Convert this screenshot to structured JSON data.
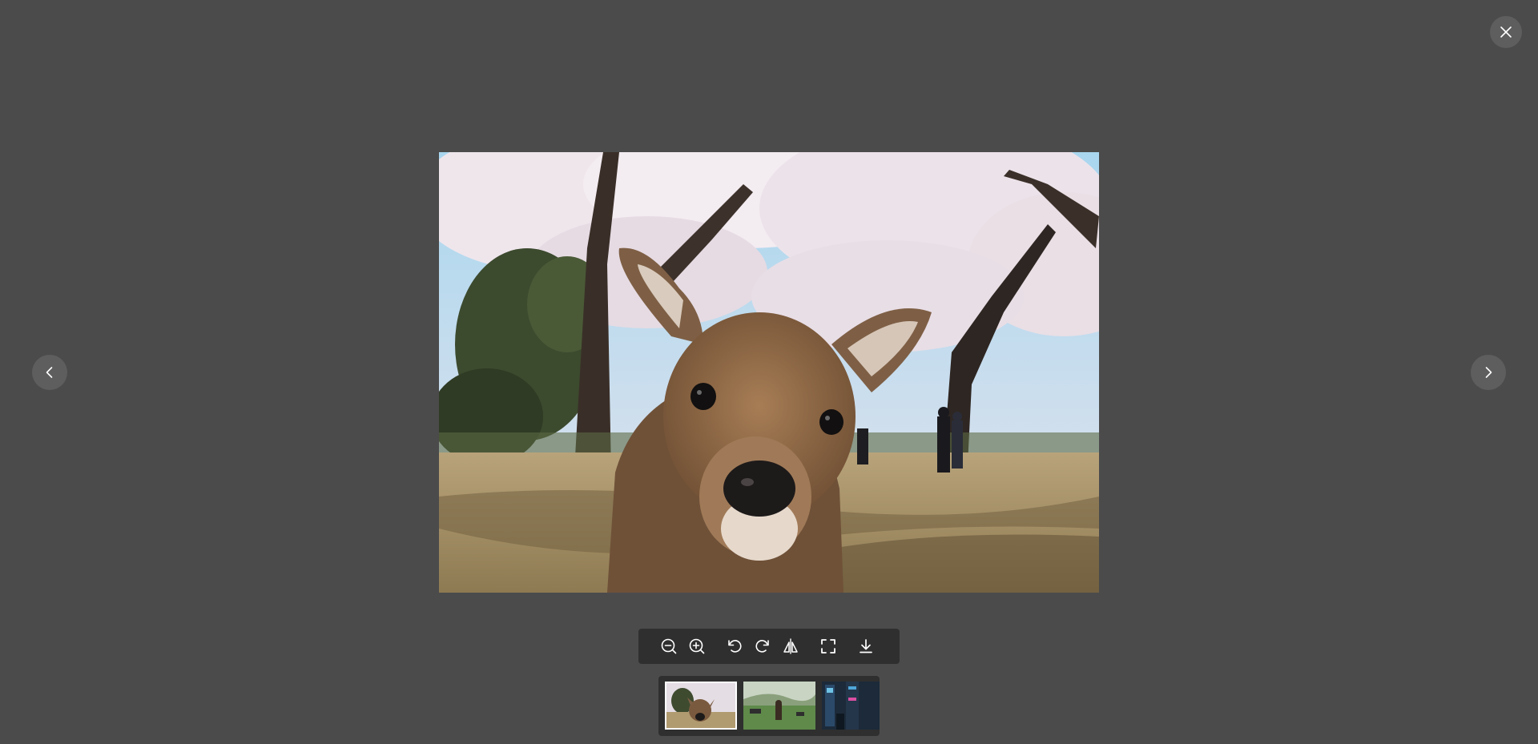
{
  "viewer": {
    "close_icon": "close-icon",
    "prev_icon": "chevron-left-icon",
    "next_icon": "chevron-right-icon",
    "main_image": "deer-under-cherry-blossoms"
  },
  "toolbar": {
    "tools": [
      {
        "name": "zoom-out",
        "icon": "zoom-out-icon"
      },
      {
        "name": "zoom-in",
        "icon": "zoom-in-icon"
      },
      {
        "name": "rotate-left",
        "icon": "rotate-left-icon"
      },
      {
        "name": "rotate-right",
        "icon": "rotate-right-icon"
      },
      {
        "name": "flip",
        "icon": "flip-icon"
      },
      {
        "name": "fullscreen",
        "icon": "fullscreen-icon"
      },
      {
        "name": "download",
        "icon": "download-icon"
      }
    ]
  },
  "thumbnails": {
    "items": [
      {
        "name": "deer",
        "active": true
      },
      {
        "name": "horse-in-field",
        "active": false
      },
      {
        "name": "city-street",
        "active": false
      }
    ]
  },
  "colors": {
    "background": "#4b4b4b",
    "button": "#5e5e5e",
    "toolbar": "#2f2f2f",
    "icon": "#ffffff"
  }
}
